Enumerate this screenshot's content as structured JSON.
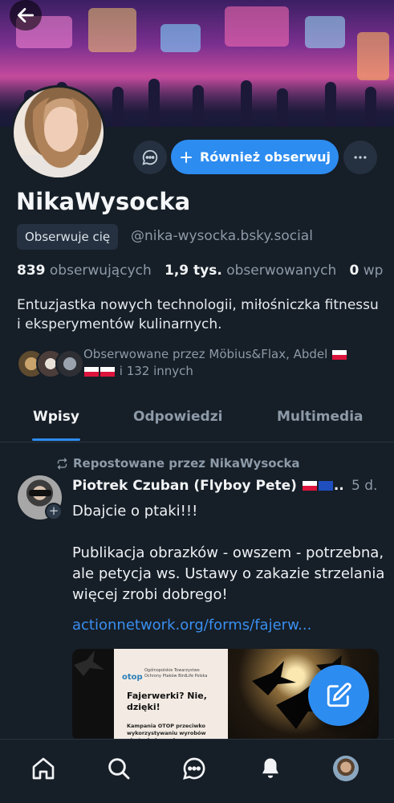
{
  "profile": {
    "display_name": "NikaWysocka",
    "follows_you_badge": "Obserwuje cię",
    "handle": "@nika-wysocka.bsky.social",
    "followers_count": "839",
    "followers_label": "obserwujących",
    "following_count": "1,9 tys.",
    "following_label": "obserwowanych",
    "posts_count": "0",
    "posts_label": "wp",
    "bio": "Entuzjastka nowych technologii, miłośniczka fitnessu i eksperymentów kulinarnych.",
    "followed_by_text": "Obserwowane przez Möbius&Flax, Abdel",
    "followed_by_more": "i 132 innych"
  },
  "actions": {
    "follow_back_label": "Również obserwuj"
  },
  "tabs": [
    {
      "label": "Wpisy",
      "active": true
    },
    {
      "label": "Odpowiedzi",
      "active": false
    },
    {
      "label": "Multimedia",
      "active": false
    }
  ],
  "post": {
    "repost_label": "Repostowane przez NikaWysocka",
    "author": "Piotrek Czuban (Flyboy Pete)",
    "author_suffix": "..",
    "time": "5 d.",
    "text_line1": "Dbajcie o ptaki!!!",
    "text_line2": "Publikacja obrazków  - owszem - potrzebna, ale petycja ws. Ustawy o zakazie strzelania więcej zrobi dobrego!",
    "link": "actionnetwork.org/forms/fajerw...",
    "media": {
      "logo": "otop",
      "org_name": "Ogólnopolskie Towarzystwo Ochrony Ptaków BirdLife Polska",
      "headline": "Fajerwerki? Nie, dzięki!",
      "caption": "Kampania OTOP przeciwko wykorzystywaniu wyrobów pirotechnicznych"
    }
  },
  "icons": {
    "back": "arrow-left-icon",
    "message": "chat-bubble-icon",
    "plus": "plus-icon",
    "more": "ellipsis-icon",
    "repost": "repost-icon",
    "compose": "compose-icon",
    "nav": [
      "home-icon",
      "search-icon",
      "chat-icon",
      "bell-icon",
      "profile-avatar"
    ]
  },
  "colors": {
    "background": "#161e27",
    "accent": "#2d8cf0",
    "muted_text": "#8d9aa8",
    "surface": "#253140"
  }
}
